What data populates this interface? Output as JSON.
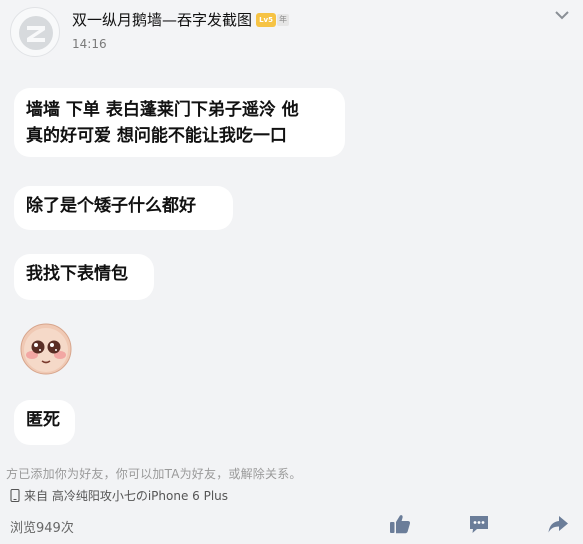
{
  "post": {
    "author_name": "双一纵月鹅墙—吞字发截图",
    "level_badge": "Lv5",
    "badge_year": "年",
    "time": "14:16"
  },
  "messages": [
    {
      "line1": "墙墙 下单 表白蓬莱门下弟子遥泠 他",
      "line2": "真的好可爱 想问能不能让我吃一口"
    },
    {
      "text": "除了是个矮子什么都好"
    },
    {
      "text": "我找下表情包"
    },
    {
      "text": "匿死"
    }
  ],
  "emoji": {
    "icon": "blushing-face-icon"
  },
  "footer": {
    "system_note": "方已添加你为好友，你可以加TA为好友，或解除关系。",
    "source": "来自 高冷纯阳攻小七のiPhone 6 Plus",
    "views": "浏览949次"
  },
  "actions": {
    "like_icon": "thumbs-up-icon",
    "comment_icon": "comment-icon",
    "share_icon": "share-icon"
  },
  "colors": {
    "background": "#f2f3f5",
    "bubble": "#ffffff",
    "action_icon": "#6b7d99"
  }
}
